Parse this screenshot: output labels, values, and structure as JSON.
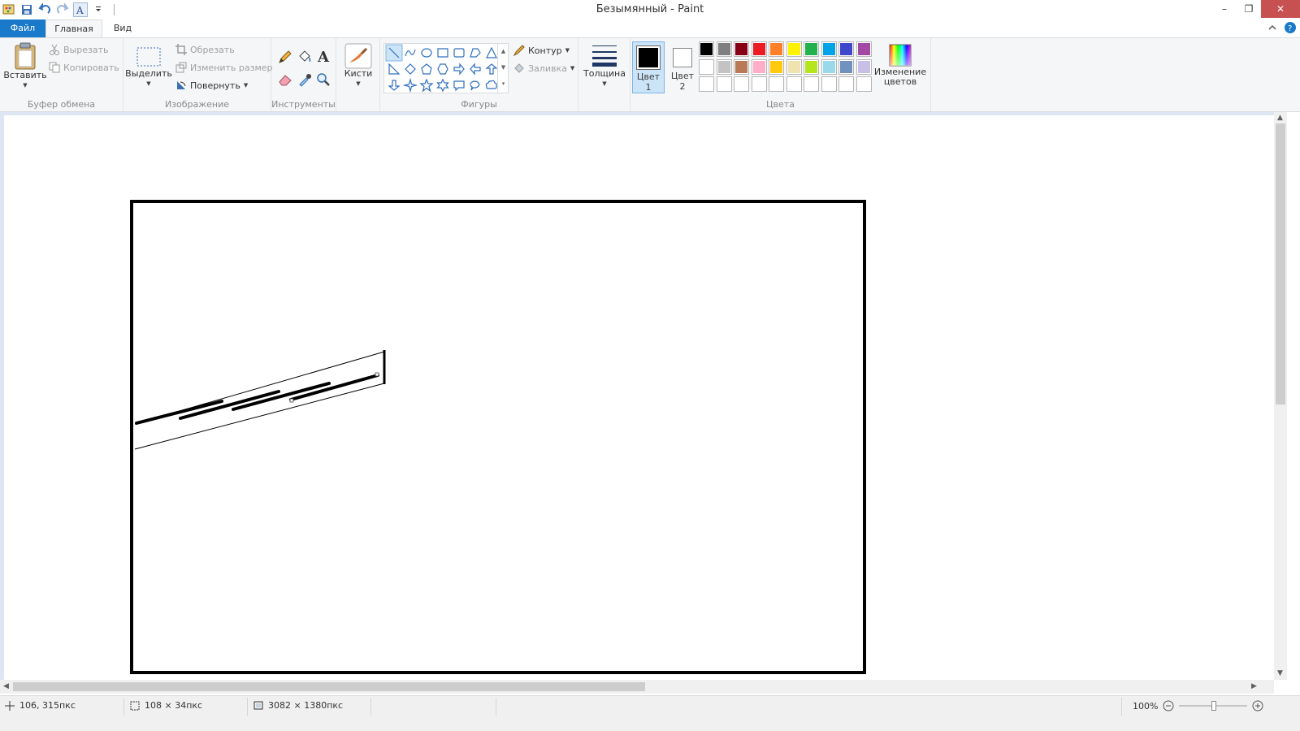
{
  "window": {
    "title": "Безымянный - Paint",
    "minimize": "–",
    "restore": "❐",
    "close": "✕"
  },
  "tabs": {
    "file": "Файл",
    "home": "Главная",
    "view": "Вид"
  },
  "ribbon": {
    "clipboard": {
      "label": "Буфер обмена",
      "paste": "Вставить",
      "cut": "Вырезать",
      "copy": "Копировать"
    },
    "image": {
      "label": "Изображение",
      "select": "Выделить",
      "crop": "Обрезать",
      "resize": "Изменить размер",
      "rotate": "Повернуть"
    },
    "tools": {
      "label": "Инструменты"
    },
    "brushes": {
      "label": "Кисти"
    },
    "shapes": {
      "label": "Фигуры",
      "outline": "Контур",
      "fill": "Заливка"
    },
    "size": {
      "label": "Толщина"
    },
    "colors": {
      "label": "Цвета",
      "color1": "Цвет 1",
      "color2": "Цвет 2",
      "edit": "Изменение цветов",
      "color1_value": "#000000",
      "color2_value": "#ffffff",
      "palette_row1": [
        "#000000",
        "#7f7f7f",
        "#880015",
        "#ed1c24",
        "#ff7f27",
        "#fff200",
        "#22b14c",
        "#00a2e8",
        "#3f48cc",
        "#a349a4"
      ],
      "palette_row2": [
        "#ffffff",
        "#c3c3c3",
        "#b97a57",
        "#ffaec9",
        "#ffc90e",
        "#efe4b0",
        "#b5e61d",
        "#99d9ea",
        "#7092be",
        "#c8bfe7"
      ],
      "palette_row3": [
        "#ffffff",
        "#ffffff",
        "#ffffff",
        "#ffffff",
        "#ffffff",
        "#ffffff",
        "#ffffff",
        "#ffffff",
        "#ffffff",
        "#ffffff"
      ]
    }
  },
  "status": {
    "cursor_pos": "106, 315пкс",
    "selection_size": "108 × 34пкс",
    "image_size": "3082 × 1380пкс",
    "zoom": "100%"
  }
}
